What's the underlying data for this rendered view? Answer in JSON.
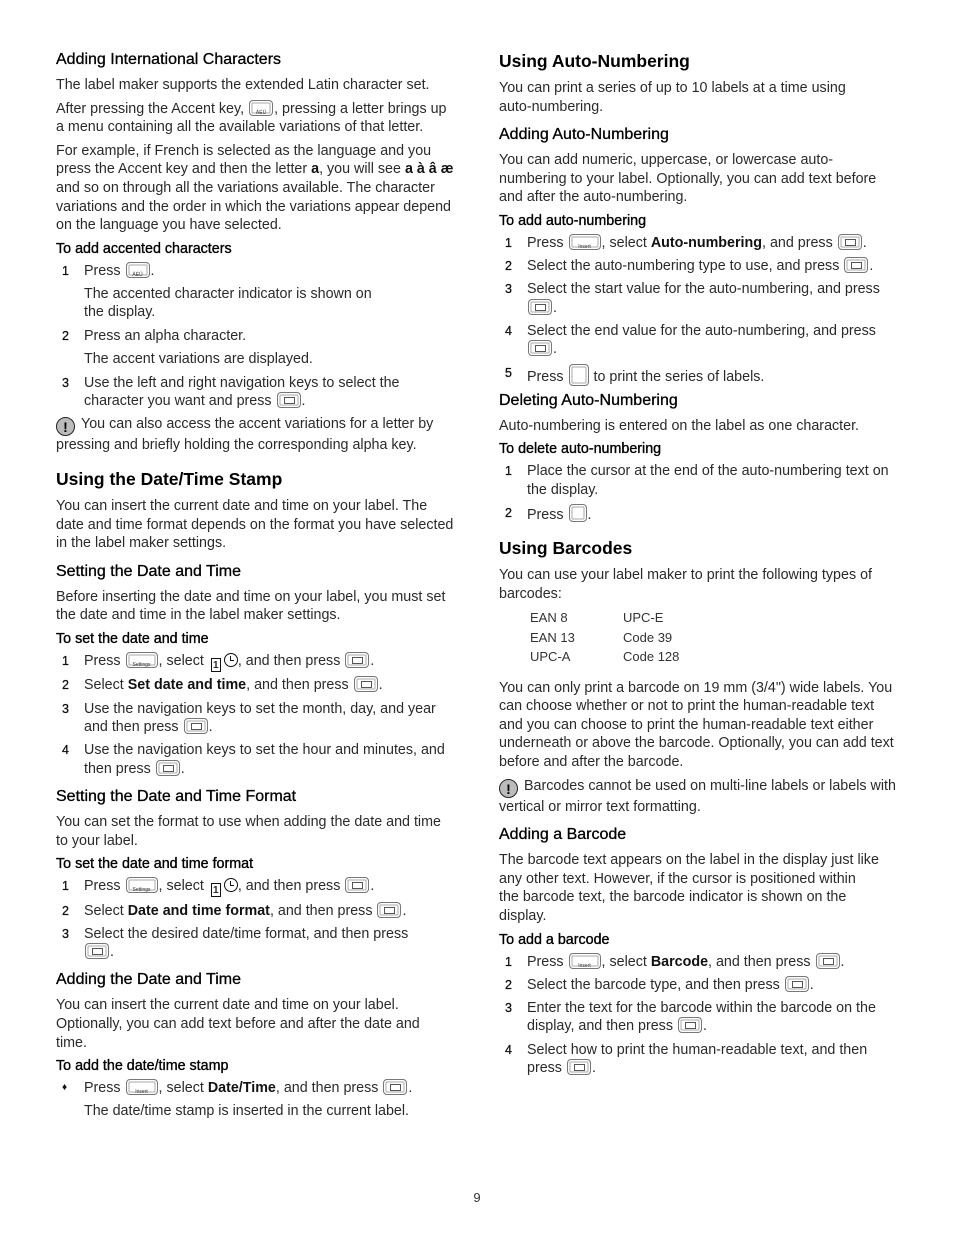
{
  "left": {
    "intl": {
      "heading": "Adding International Characters",
      "p1": "The label maker supports the extended Latin character set.",
      "p2_a": "After pressing the Accent key,",
      "p2_b": ", pressing a letter brings up a menu containing all the available variations of that letter.",
      "p3_a": "For example, if French is selected as the language and you press the Accent key and then the letter",
      "p3_letter": "a",
      "p3_b": ", you will see",
      "p3_chars": "a à â æ",
      "p3_c": "and so on through all the variations available. The character variations and the order in which the variations appear depend on the language you have selected.",
      "proc_title": "To add accented characters",
      "steps": [
        {
          "num": "1",
          "a": "Press",
          "b": ".",
          "result": "The accented character indicator is shown on the display."
        },
        {
          "num": "2",
          "a": "Press an alpha character.",
          "result": "The accent variations are displayed."
        },
        {
          "num": "3",
          "a": "Use the left and right navigation keys to select the character you want and press",
          "b": "."
        }
      ],
      "note": "You can also access the accent variations for a letter by pressing and briefly holding the corresponding alpha key."
    },
    "datetime": {
      "heading": "Using the Date/Time Stamp",
      "intro": "You can insert the current date and time on your label. The date and time format depends on the format you have selected in the label maker settings.",
      "set": {
        "heading": "Setting the Date and Time",
        "intro": "Before inserting the date and time on your label, you must set the date and time in the label maker settings.",
        "proc_title": "To set the date and time",
        "steps": [
          {
            "num": "1",
            "a": "Press",
            "b": ", select",
            "c": ", and then press",
            "d": "."
          },
          {
            "num": "2",
            "a": "Select",
            "bold": "Set date and time",
            "b": ", and then press",
            "c": "."
          },
          {
            "num": "3",
            "a": "Use the navigation keys to set the month, day, and year and then press",
            "b": "."
          },
          {
            "num": "4",
            "a": "Use the navigation keys to set the hour and minutes, and then press",
            "b": "."
          }
        ]
      },
      "format": {
        "heading": "Setting the Date and Time Format",
        "intro": "You can set the format to use when adding the date and time to your label.",
        "proc_title": "To set the date and time format",
        "steps": [
          {
            "num": "1",
            "a": "Press",
            "b": ", select",
            "c": ", and then press",
            "d": "."
          },
          {
            "num": "2",
            "a": "Select",
            "bold": "Date and time format",
            "b": ", and then press",
            "c": "."
          },
          {
            "num": "3",
            "a": "Select the desired date/time format, and then press",
            "b": "."
          }
        ]
      },
      "add": {
        "heading": "Adding the Date and Time",
        "intro": "You can insert the current date and time on your label. Optionally, you can add text before and after the date and time.",
        "proc_title": "To add the date/time stamp",
        "step": {
          "bullet": "♦",
          "a": "Press",
          "b": ", select",
          "bold": "Date/Time",
          "c": ", and then press",
          "d": "."
        },
        "result": "The date/time stamp is inserted in the current label."
      }
    }
  },
  "right": {
    "autonum": {
      "heading": "Using Auto-Numbering",
      "intro": "You can print a series of up to 10 labels at a time using auto-numbering.",
      "add": {
        "heading": "Adding Auto-Numbering",
        "intro": "You can add numeric, uppercase, or lowercase auto-numbering to your label. Optionally, you can add text before and after the auto-numbering.",
        "proc_title": "To add auto-numbering",
        "steps": [
          {
            "num": "1",
            "a": "Press",
            "b": ", select",
            "bold": "Auto-numbering",
            "c": ", and press",
            "d": "."
          },
          {
            "num": "2",
            "a": "Select the auto-numbering type to use, and press",
            "b": "."
          },
          {
            "num": "3",
            "a": "Select the start value for the auto-numbering, and press",
            "b": "."
          },
          {
            "num": "4",
            "a": "Select the end value for the auto-numbering, and press",
            "b": "."
          },
          {
            "num": "5",
            "a": "Press",
            "b": "to print the series of labels."
          }
        ]
      },
      "del": {
        "heading": "Deleting Auto-Numbering",
        "intro": "Auto-numbering is entered on the label as one character.",
        "proc_title": "To delete auto-numbering",
        "steps": [
          {
            "num": "1",
            "a": "Place the cursor at the end of the auto-numbering text on the display."
          },
          {
            "num": "2",
            "a": "Press",
            "b": "."
          }
        ]
      }
    },
    "barcodes": {
      "heading": "Using Barcodes",
      "intro": "You can use your label maker to print the following types of barcodes:",
      "types": [
        "EAN 8",
        "UPC-E",
        "EAN 13",
        "Code 39",
        "UPC-A",
        "Code 128"
      ],
      "p2": "You can only print a barcode on 19 mm (3/4\") wide labels. You can choose whether or not to print the human-readable text and you can choose to print the human-readable text either underneath or above the barcode. Optionally, you can add text before and after the barcode.",
      "note": "Barcodes cannot be used on multi-line labels or labels with vertical or mirror text formatting.",
      "add": {
        "heading": "Adding a Barcode",
        "intro": "The barcode text appears on the label in the display just like any other text. However, if the cursor is positioned within the barcode text, the barcode indicator is shown on the display.",
        "proc_title": "To add a barcode",
        "steps": [
          {
            "num": "1",
            "a": "Press",
            "b": ", select",
            "bold": "Barcode",
            "c": ", and then press",
            "d": "."
          },
          {
            "num": "2",
            "a": "Select the barcode type, and then press",
            "b": "."
          },
          {
            "num": "3",
            "a": "Enter the text for the barcode within the barcode on the display, and then press",
            "b": "."
          },
          {
            "num": "4",
            "a": "Select how to print the human-readable text, and then press",
            "b": "."
          }
        ]
      }
    }
  },
  "keys": {
    "accent": "ÀÉÜ",
    "settings": "Settings",
    "insert": "Insert",
    "calendar_digit": "1",
    "warning_glyph": "!"
  },
  "page_number": "9"
}
